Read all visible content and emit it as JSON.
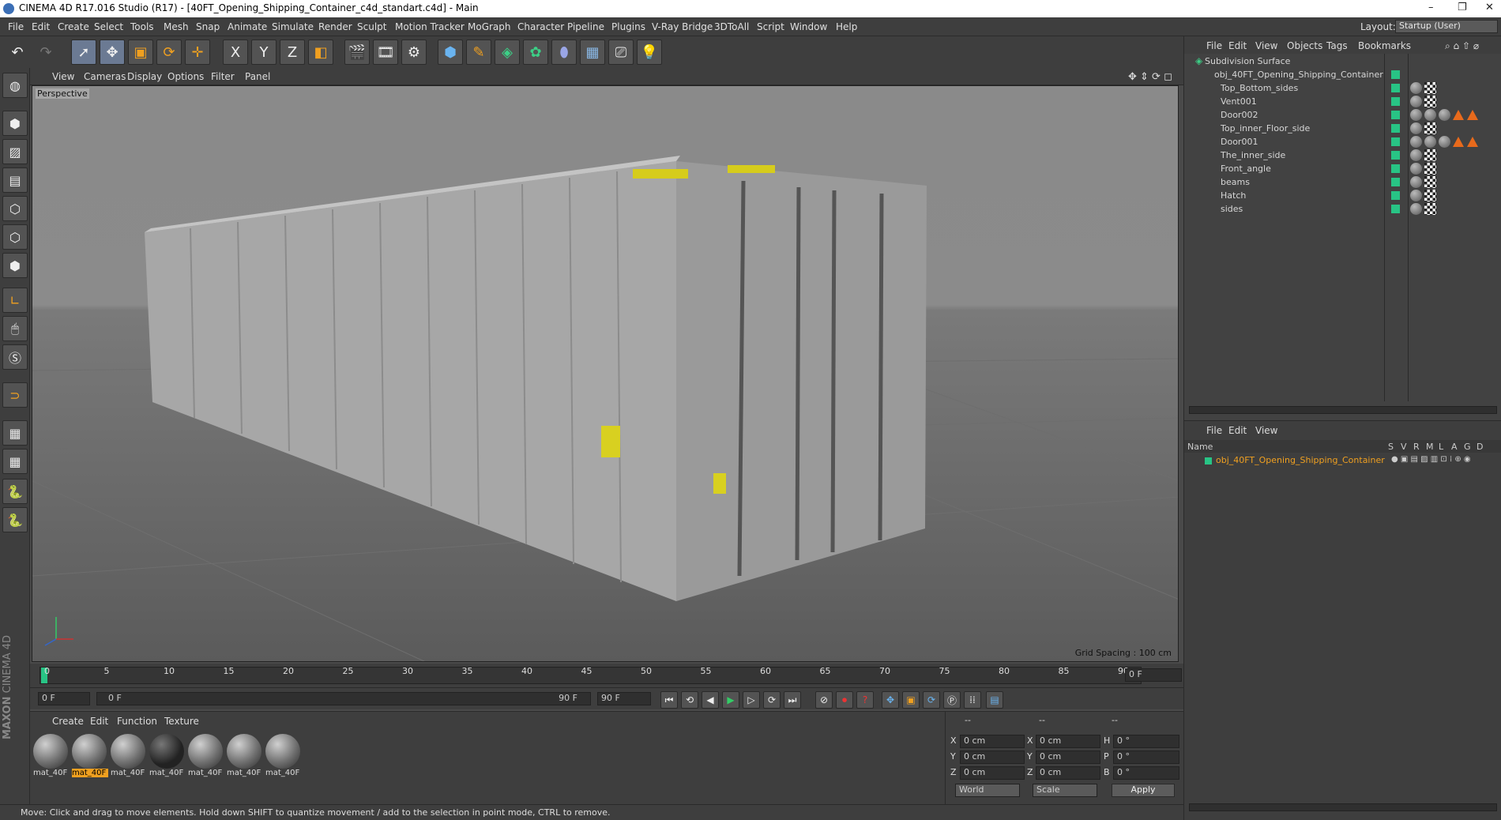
{
  "titlebar": {
    "title": "CINEMA 4D R17.016 Studio (R17) - [40FT_Opening_Shipping_Container_c4d_standart.c4d] - Main",
    "minimize": "–",
    "restore": "❐",
    "close": "✕"
  },
  "menu": [
    "File",
    "Edit",
    "Create",
    "Select",
    "Tools",
    "Mesh",
    "Snap",
    "Animate",
    "Simulate",
    "Render",
    "Sculpt",
    "Motion Tracker",
    "MoGraph",
    "Character",
    "Pipeline",
    "Plugins",
    "V-Ray Bridge",
    "3DToAll",
    "Script",
    "Window",
    "Help"
  ],
  "layout": {
    "label": "Layout:",
    "value": "Startup (User)"
  },
  "toolbar": {
    "icons": [
      "undo-icon",
      "redo-icon",
      "select-arrow-icon",
      "move-icon",
      "scale-icon",
      "rotate-icon",
      "live-select-icon",
      "x-axis-icon",
      "y-axis-icon",
      "z-axis-icon",
      "coordinate-system-icon",
      "render-view-icon",
      "render-picture-viewer-icon",
      "render-settings-icon",
      "cube-icon",
      "pen-icon",
      "subdivision-icon",
      "cloner-icon",
      "deformer-icon",
      "floor-icon",
      "camera-icon",
      "light-icon"
    ],
    "axis_labels": [
      "X",
      "Y",
      "Z"
    ]
  },
  "viewport_menu": [
    "View",
    "Cameras",
    "Display",
    "Options",
    "Filter",
    "Panel"
  ],
  "viewport": {
    "label": "Perspective",
    "grid_spacing": "Grid Spacing : 100 cm"
  },
  "timeline": {
    "ticks": [
      "0",
      "5",
      "10",
      "15",
      "20",
      "25",
      "30",
      "35",
      "40",
      "45",
      "50",
      "55",
      "60",
      "65",
      "70",
      "75",
      "80",
      "85",
      "90"
    ],
    "current_frame_field": "0 F"
  },
  "timectrl": {
    "start": "0 F",
    "range_start": "0 F",
    "range_end": "90 F",
    "end": "90 F"
  },
  "material_menu": [
    "Create",
    "Edit",
    "Function",
    "Texture"
  ],
  "materials": [
    {
      "name": "mat_40F",
      "selected": false
    },
    {
      "name": "mat_40F",
      "selected": true
    },
    {
      "name": "mat_40F",
      "selected": false
    },
    {
      "name": "mat_40F",
      "selected": false
    },
    {
      "name": "mat_40F",
      "selected": false
    },
    {
      "name": "mat_40F",
      "selected": false
    },
    {
      "name": "mat_40F",
      "selected": false
    }
  ],
  "coords": {
    "headers": [
      "--",
      "--",
      "--"
    ],
    "rows": [
      {
        "a": "X",
        "av": "0 cm",
        "b": "X",
        "bv": "0 cm",
        "c": "H",
        "cv": "0 °"
      },
      {
        "a": "Y",
        "av": "0 cm",
        "b": "Y",
        "bv": "0 cm",
        "c": "P",
        "cv": "0 °"
      },
      {
        "a": "Z",
        "av": "0 cm",
        "b": "Z",
        "bv": "0 cm",
        "c": "B",
        "cv": "0 °"
      }
    ],
    "world": "World",
    "scale": "Scale",
    "apply": "Apply"
  },
  "status": "Move: Click and drag to move elements. Hold down SHIFT to quantize movement / add to the selection in point mode, CTRL to remove.",
  "objmgr": {
    "menu": [
      "File",
      "Edit",
      "View",
      "Objects",
      "Tags",
      "Bookmarks"
    ],
    "objects": [
      "Subdivision Surface",
      "obj_40FT_Opening_Shipping_Container",
      "Top_Bottom_sides",
      "Vent001",
      "Door002",
      "Top_inner_Floor_side",
      "Door001",
      "The_inner_side",
      "Front_angle",
      "beams",
      "Hatch",
      "sides"
    ]
  },
  "attrmgr": {
    "menu": [
      "File",
      "Edit",
      "View"
    ],
    "columns": [
      "Name",
      "S",
      "V",
      "R",
      "M",
      "L",
      "A",
      "G",
      "D"
    ],
    "object": "obj_40FT_Opening_Shipping_Container"
  },
  "brand": [
    "MAXON",
    "CINEMA 4D"
  ],
  "colors": {
    "accent": "#f0a020",
    "object_dot": "#28c485",
    "panel": "#3e3e3e"
  }
}
